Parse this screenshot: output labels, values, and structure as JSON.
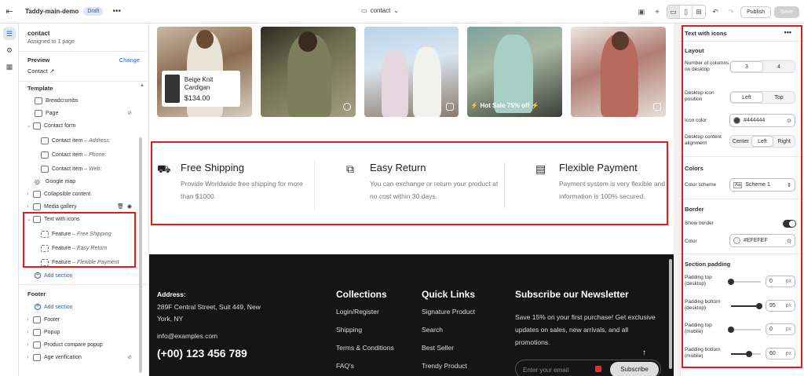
{
  "topbar": {
    "store": "Taddy-main-demo",
    "badge": "Draft",
    "page": "contact",
    "publish": "Publish",
    "save": "Save"
  },
  "sidebar": {
    "title": "contact",
    "subtitle": "Assigned to 1 page",
    "preview_label": "Preview",
    "change": "Change",
    "preview_value": "Contact",
    "template_head": "Template",
    "items": [
      {
        "label": "Breadcrumbs",
        "sub": ""
      },
      {
        "label": "Page",
        "sub": ""
      },
      {
        "label": "Contact form",
        "sub": ""
      },
      {
        "label": "Contact item",
        "sub": "Address:"
      },
      {
        "label": "Contact item",
        "sub": "Phone:"
      },
      {
        "label": "Contact item",
        "sub": "Web:"
      },
      {
        "label": "Google map",
        "sub": ""
      },
      {
        "label": "Collapsible content",
        "sub": ""
      },
      {
        "label": "Media gallery",
        "sub": ""
      },
      {
        "label": "Text with icons",
        "sub": ""
      },
      {
        "label": "Feature",
        "sub": "Free Shipping"
      },
      {
        "label": "Feature",
        "sub": "Easy Return"
      },
      {
        "label": "Feature",
        "sub": "Flexible Payment"
      }
    ],
    "add_section": "Add section",
    "footer_head": "Footer",
    "footer_add": "Add section",
    "footer_items": [
      "Footer",
      "Popup",
      "Product compare popup",
      "Age verification"
    ],
    "dash": "–"
  },
  "canvas": {
    "card_name": "Beige Knit Cardigan",
    "card_price": "$134.00",
    "marquee": "Hot Sale 75% off",
    "features": [
      {
        "title": "Free Shipping",
        "desc": "Provide Worldwide free shipping for more than $1000."
      },
      {
        "title": "Easy Return",
        "desc": "You can exchange or return your product at no cost within 30 days."
      },
      {
        "title": "Flexible Payment",
        "desc": "Payment system is very flexible and information is 100% secured."
      }
    ],
    "footer": {
      "address_head": "Address:",
      "address": "289F Central Street, Suit 449, New York, NY",
      "email": "info@examples.com",
      "phone": "(+00) 123 456 789",
      "collections_head": "Collections",
      "collections": [
        "Login/Register",
        "Shipping",
        "Terms & Conditions",
        "FAQ's"
      ],
      "links_head": "Quick Links",
      "links": [
        "Signature Product",
        "Search",
        "Best Seller",
        "Trendy Product"
      ],
      "newsletter_head": "Subscribe our Newsletter",
      "newsletter_text": "Save 15% on your first purchase! Get exclusive updates on sales, new arrivals, and all promotions.",
      "email_placeholder": "Enter your email",
      "subscribe": "Subscribe"
    }
  },
  "settings": {
    "title": "Text with icons",
    "layout_head": "Layout",
    "columns_label": "Number of columns on desktop",
    "columns_options": [
      "3",
      "4"
    ],
    "columns_selected": "3",
    "icon_pos_label": "Desktop icon position",
    "icon_pos_options": [
      "Left",
      "Top"
    ],
    "icon_pos_selected": "Left",
    "icon_color_label": "Icon color",
    "icon_color": "#444444",
    "align_label": "Desktop content alignment",
    "align_options": [
      "Center",
      "Left",
      "Right"
    ],
    "align_selected": "Left",
    "colors_head": "Colors",
    "scheme_label": "Color scheme",
    "scheme_value": "Scheme 1",
    "border_head": "Border",
    "show_border_label": "Show border",
    "show_border": true,
    "border_color_label": "Color",
    "border_color": "#EFEFEF",
    "padding_head": "Section padding",
    "padding": [
      {
        "label": "Padding top (desktop)",
        "value": "0",
        "unit": "px",
        "fraction": 0.0
      },
      {
        "label": "Padding bottom (desktop)",
        "value": "95",
        "unit": "px",
        "fraction": 0.95
      },
      {
        "label": "Padding top (mobile)",
        "value": "0",
        "unit": "px",
        "fraction": 0.0
      },
      {
        "label": "Padding bottom (mobile)",
        "value": "60",
        "unit": "px",
        "fraction": 0.6
      }
    ]
  }
}
